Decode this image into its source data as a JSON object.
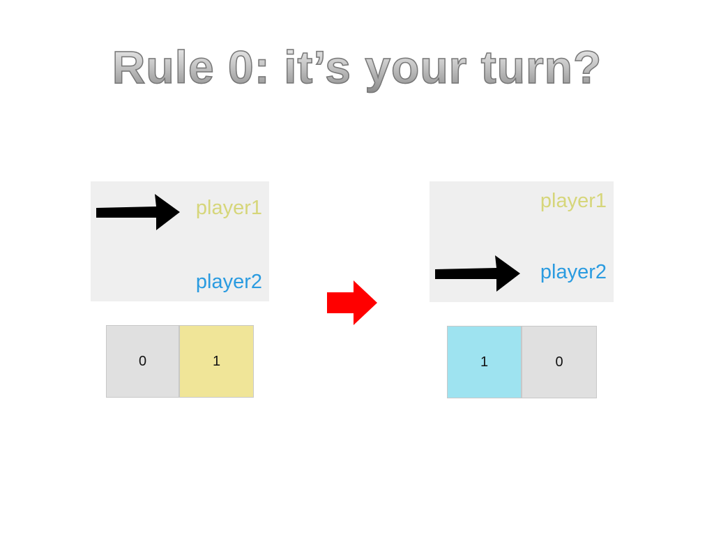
{
  "slide": {
    "title": "Rule 0: it’s your turn?",
    "before": {
      "player1": "player1",
      "player2": "player2",
      "turn_indicator": "player1",
      "scores": [
        {
          "value": "0",
          "color": "#e0e0e0"
        },
        {
          "value": "1",
          "color": "#f0e598"
        }
      ]
    },
    "transition_icon": "red-right-arrow",
    "after": {
      "player1": "player1",
      "player2": "player2",
      "turn_indicator": "player2",
      "scores": [
        {
          "value": "1",
          "color": "#9ee3f0"
        },
        {
          "value": "0",
          "color": "#e0e0e0"
        }
      ]
    },
    "colors": {
      "player1": "#d6d67a",
      "player2": "#2a9be0",
      "transition_arrow": "#ff0000"
    }
  }
}
